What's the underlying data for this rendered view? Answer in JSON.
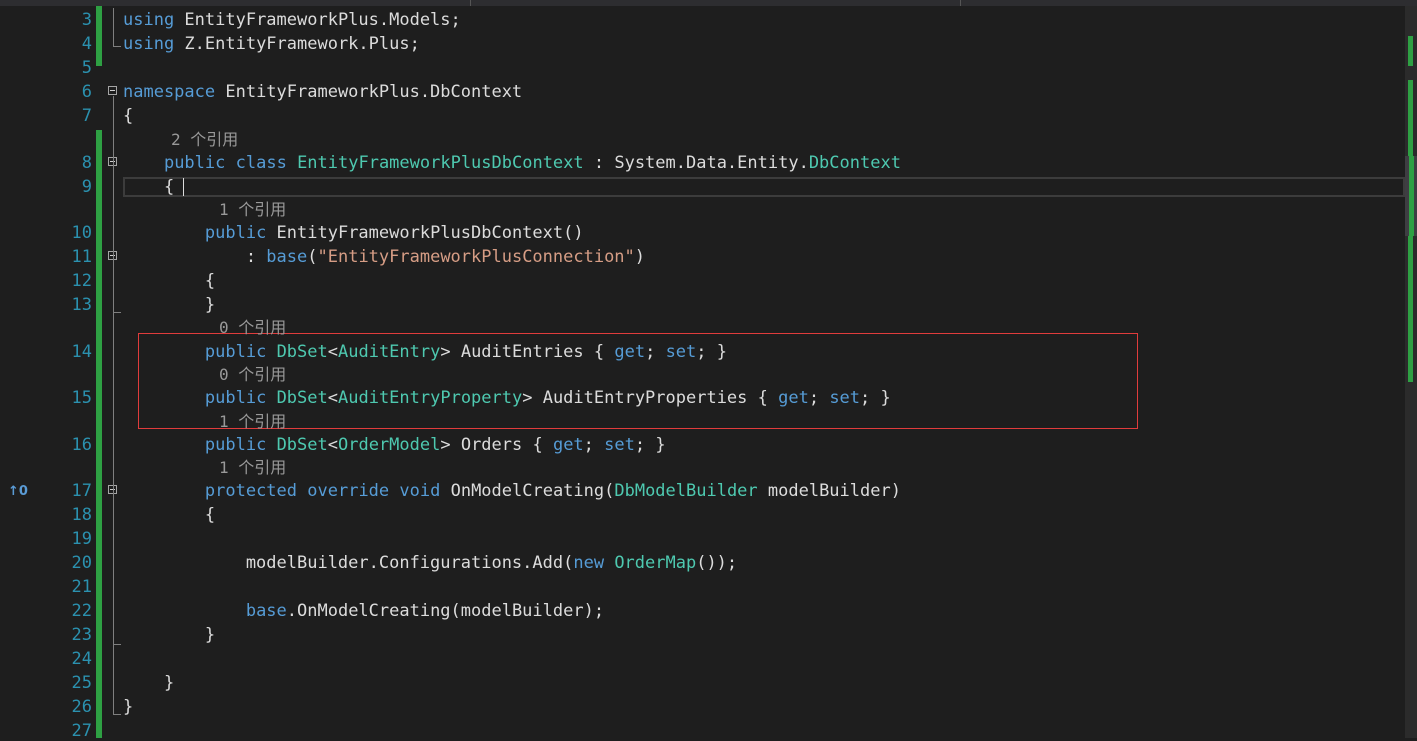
{
  "editor": {
    "lines": [
      {
        "num": "3",
        "segments": [
          {
            "t": "using",
            "c": "kw"
          },
          {
            "t": " EntityFrameworkPlus.Models;",
            "c": "pl"
          }
        ]
      },
      {
        "num": "4",
        "segments": [
          {
            "t": "using",
            "c": "kw"
          },
          {
            "t": " Z.EntityFramework.Plus;",
            "c": "pl"
          }
        ]
      },
      {
        "num": "5",
        "segments": []
      },
      {
        "num": "6",
        "segments": [
          {
            "t": "namespace",
            "c": "kw"
          },
          {
            "t": " EntityFrameworkPlus.DbContext",
            "c": "pl"
          }
        ]
      },
      {
        "num": "7",
        "segments": [
          {
            "t": "{",
            "c": "pl"
          }
        ]
      },
      {
        "num": "8",
        "ref": "2 个引用",
        "segments": [
          {
            "t": "    ",
            "c": "pl"
          },
          {
            "t": "public",
            "c": "kw"
          },
          {
            "t": " ",
            "c": "pl"
          },
          {
            "t": "class",
            "c": "kw"
          },
          {
            "t": " ",
            "c": "pl"
          },
          {
            "t": "EntityFrameworkPlusDbContext",
            "c": "ty"
          },
          {
            "t": " : System.Data.Entity.",
            "c": "pl"
          },
          {
            "t": "DbContext",
            "c": "ty"
          }
        ]
      },
      {
        "num": "9",
        "segments": [
          {
            "t": "    {",
            "c": "pl"
          }
        ]
      },
      {
        "num": "10",
        "ref": "1 个引用",
        "segments": [
          {
            "t": "        ",
            "c": "pl"
          },
          {
            "t": "public",
            "c": "kw"
          },
          {
            "t": " EntityFrameworkPlusDbContext()",
            "c": "pl"
          }
        ]
      },
      {
        "num": "11",
        "segments": [
          {
            "t": "            : ",
            "c": "pl"
          },
          {
            "t": "base",
            "c": "kw"
          },
          {
            "t": "(",
            "c": "pl"
          },
          {
            "t": "\"EntityFrameworkPlusConnection\"",
            "c": "str"
          },
          {
            "t": ")",
            "c": "pl"
          }
        ]
      },
      {
        "num": "12",
        "segments": [
          {
            "t": "        {",
            "c": "pl"
          }
        ]
      },
      {
        "num": "13",
        "segments": [
          {
            "t": "        }",
            "c": "pl"
          }
        ]
      },
      {
        "num": "14",
        "ref": "0 个引用",
        "segments": [
          {
            "t": "        ",
            "c": "pl"
          },
          {
            "t": "public",
            "c": "kw"
          },
          {
            "t": " ",
            "c": "pl"
          },
          {
            "t": "DbSet",
            "c": "ty"
          },
          {
            "t": "<",
            "c": "pl"
          },
          {
            "t": "AuditEntry",
            "c": "ty"
          },
          {
            "t": "> AuditEntries { ",
            "c": "pl"
          },
          {
            "t": "get",
            "c": "kw"
          },
          {
            "t": "; ",
            "c": "pl"
          },
          {
            "t": "set",
            "c": "kw"
          },
          {
            "t": "; }",
            "c": "pl"
          }
        ]
      },
      {
        "num": "15",
        "ref": "0 个引用",
        "segments": [
          {
            "t": "        ",
            "c": "pl"
          },
          {
            "t": "public",
            "c": "kw"
          },
          {
            "t": " ",
            "c": "pl"
          },
          {
            "t": "DbSet",
            "c": "ty"
          },
          {
            "t": "<",
            "c": "pl"
          },
          {
            "t": "AuditEntryProperty",
            "c": "ty"
          },
          {
            "t": "> AuditEntryProperties { ",
            "c": "pl"
          },
          {
            "t": "get",
            "c": "kw"
          },
          {
            "t": "; ",
            "c": "pl"
          },
          {
            "t": "set",
            "c": "kw"
          },
          {
            "t": "; }",
            "c": "pl"
          }
        ]
      },
      {
        "num": "16",
        "ref": "1 个引用",
        "segments": [
          {
            "t": "        ",
            "c": "pl"
          },
          {
            "t": "public",
            "c": "kw"
          },
          {
            "t": " ",
            "c": "pl"
          },
          {
            "t": "DbSet",
            "c": "ty"
          },
          {
            "t": "<",
            "c": "pl"
          },
          {
            "t": "OrderModel",
            "c": "ty"
          },
          {
            "t": "> Orders { ",
            "c": "pl"
          },
          {
            "t": "get",
            "c": "kw"
          },
          {
            "t": "; ",
            "c": "pl"
          },
          {
            "t": "set",
            "c": "kw"
          },
          {
            "t": "; }",
            "c": "pl"
          }
        ]
      },
      {
        "num": "17",
        "ref": "1 个引用",
        "segments": [
          {
            "t": "        ",
            "c": "pl"
          },
          {
            "t": "protected",
            "c": "kw"
          },
          {
            "t": " ",
            "c": "pl"
          },
          {
            "t": "override",
            "c": "kw"
          },
          {
            "t": " ",
            "c": "pl"
          },
          {
            "t": "void",
            "c": "kw"
          },
          {
            "t": " OnModelCreating(",
            "c": "pl"
          },
          {
            "t": "DbModelBuilder",
            "c": "ty"
          },
          {
            "t": " modelBuilder)",
            "c": "pl"
          }
        ]
      },
      {
        "num": "18",
        "segments": [
          {
            "t": "        {",
            "c": "pl"
          }
        ]
      },
      {
        "num": "19",
        "segments": []
      },
      {
        "num": "20",
        "segments": [
          {
            "t": "            modelBuilder.Configurations.Add(",
            "c": "pl"
          },
          {
            "t": "new",
            "c": "kw"
          },
          {
            "t": " ",
            "c": "pl"
          },
          {
            "t": "OrderMap",
            "c": "ty"
          },
          {
            "t": "());",
            "c": "pl"
          }
        ]
      },
      {
        "num": "21",
        "segments": []
      },
      {
        "num": "22",
        "segments": [
          {
            "t": "            ",
            "c": "pl"
          },
          {
            "t": "base",
            "c": "kw"
          },
          {
            "t": ".OnModelCreating(modelBuilder);",
            "c": "pl"
          }
        ]
      },
      {
        "num": "23",
        "segments": [
          {
            "t": "        }",
            "c": "pl"
          }
        ]
      },
      {
        "num": "24",
        "segments": []
      },
      {
        "num": "25",
        "segments": [
          {
            "t": "    }",
            "c": "pl"
          }
        ]
      },
      {
        "num": "26",
        "segments": [
          {
            "t": "}",
            "c": "pl"
          }
        ]
      },
      {
        "num": "27",
        "segments": []
      }
    ],
    "override_marker": "↑0"
  },
  "colors": {
    "keyword": "#569cd6",
    "type": "#4ec9b0",
    "string": "#d69d85",
    "plain": "#dcdcdc",
    "line_number": "#2b91af",
    "codelens": "#999999",
    "change_bar": "#2ea043",
    "highlight_box": "#e03c3c",
    "background": "#1e1e1e"
  }
}
